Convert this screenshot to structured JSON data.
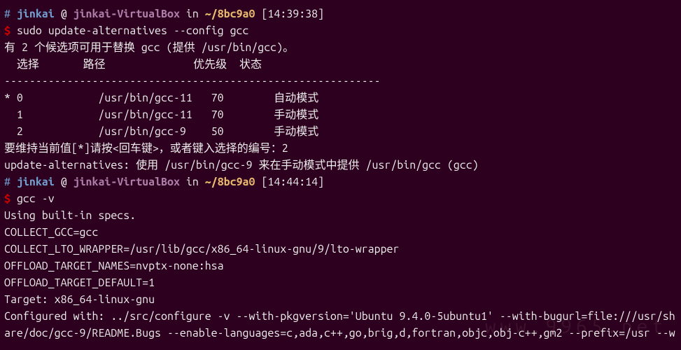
{
  "prompt1": {
    "hash": "#",
    "user": "jinkai",
    "at": "@",
    "host": "jinkai-VirtualBox",
    "in": "in",
    "path": "~/8bc9a0",
    "time": "[14:39:38]"
  },
  "cmd1": {
    "dollar": "$",
    "text": "sudo update-alternatives --config gcc"
  },
  "out1_l1": "有 2 个候选项可用于替换 gcc (提供 /usr/bin/gcc)。",
  "blank": "",
  "header": "  选择       路径              优先级  状态",
  "divider": "------------------------------------------------------------",
  "row0": "* 0            /usr/bin/gcc-11   70        自动模式",
  "row1": "  1            /usr/bin/gcc-11   70        手动模式",
  "row2": "  2            /usr/bin/gcc-9    50        手动模式",
  "prompt_select": "要维持当前值[*]请按<回车键>，或者键入选择的编号：2",
  "confirm": "update-alternatives: 使用 /usr/bin/gcc-9 来在手动模式中提供 /usr/bin/gcc (gcc)",
  "prompt2": {
    "hash": "#",
    "user": "jinkai",
    "at": "@",
    "host": "jinkai-VirtualBox",
    "in": "in",
    "path": "~/8bc9a0",
    "time": "[14:44:14]"
  },
  "cmd2": {
    "dollar": "$",
    "text": "gcc -v"
  },
  "gcc_l1": "Using built-in specs.",
  "gcc_l2": "COLLECT_GCC=gcc",
  "gcc_l3": "COLLECT_LTO_WRAPPER=/usr/lib/gcc/x86_64-linux-gnu/9/lto-wrapper",
  "gcc_l4": "OFFLOAD_TARGET_NAMES=nvptx-none:hsa",
  "gcc_l5": "OFFLOAD_TARGET_DEFAULT=1",
  "gcc_l6": "Target: x86_64-linux-gnu",
  "gcc_l7": "Configured with: ../src/configure -v --with-pkgversion='Ubuntu 9.4.0-5ubuntu1' --with-bugurl=file:///usr/sh",
  "gcc_l8": "are/doc/gcc-9/README.Bugs --enable-languages=c,ada,c++,go,brig,d,fortran,objc,obj-c++,gm2 --prefix=/usr --w",
  "watermark": "www.9965.net"
}
